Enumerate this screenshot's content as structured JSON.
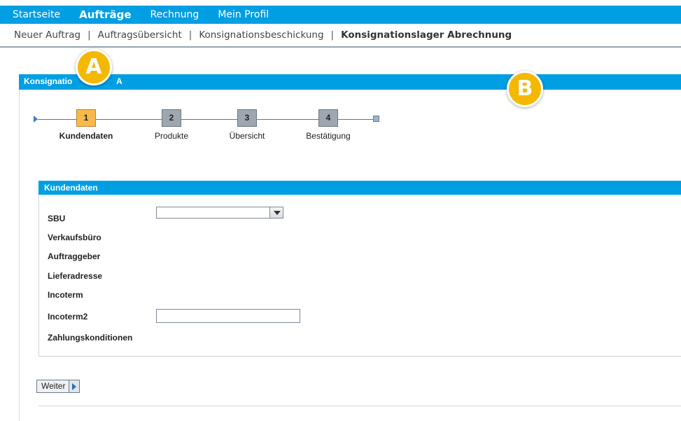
{
  "topnav": {
    "items": [
      {
        "label": "Startseite"
      },
      {
        "label": "Aufträge"
      },
      {
        "label": "Rechnung"
      },
      {
        "label": "Mein Profil"
      }
    ]
  },
  "subnav": {
    "items": [
      {
        "label": "Neuer Auftrag"
      },
      {
        "label": "Auftragsübersicht"
      },
      {
        "label": "Konsignationsbeschickung"
      },
      {
        "label": "Konsignationslager Abrechnung"
      }
    ],
    "separator": "|"
  },
  "panel": {
    "title": "Konsignatio",
    "title_tail": "A"
  },
  "wizard": {
    "steps": [
      {
        "number": "1",
        "label": "Kundendaten"
      },
      {
        "number": "2",
        "label": "Produkte"
      },
      {
        "number": "3",
        "label": "Übersicht"
      },
      {
        "number": "4",
        "label": "Bestätigung"
      }
    ]
  },
  "form": {
    "section_title": "Kundendaten",
    "fields": {
      "sbu": "SBU",
      "verkaufsbuero": "Verkaufsbüro",
      "auftraggeber": "Auftraggeber",
      "lieferadresse": "Lieferadresse",
      "incoterm": "Incoterm",
      "incoterm2": "Incoterm2",
      "zahlungskonditionen": "Zahlungskonditionen"
    },
    "sbu_value": "",
    "incoterm2_value": ""
  },
  "buttons": {
    "weiter": "Weiter"
  },
  "annotations": {
    "a": "A",
    "b": "B"
  },
  "colors": {
    "primary": "#009fe3",
    "active_step": "#f9b94a",
    "inactive_step": "#9ea7b0",
    "annotation": "#f5b800"
  }
}
